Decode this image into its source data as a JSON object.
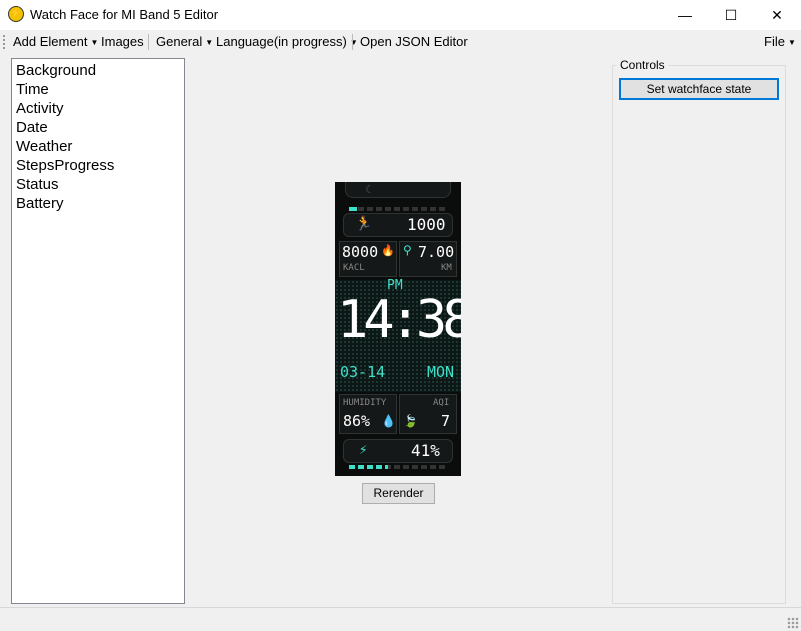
{
  "window": {
    "title": "Watch Face for MI Band 5 Editor",
    "minimize_glyph": "—",
    "maximize_glyph": "☐",
    "close_glyph": "✕"
  },
  "menu": {
    "add_element": "Add Element",
    "images": "Images",
    "general": "General",
    "language": "Language(in progress)",
    "open_json": "Open JSON Editor",
    "file": "File"
  },
  "elements": [
    "Background",
    "Time",
    "Activity",
    "Date",
    "Weather",
    "StepsProgress",
    "Status",
    "Battery"
  ],
  "controls": {
    "label": "Controls",
    "set_state_button": "Set watchface state"
  },
  "rerender_button": "Rerender",
  "watch": {
    "steps": "1000",
    "kcal_value": "8000",
    "kcal_label": "KACL",
    "distance_value": "7.00",
    "distance_label": "KM",
    "ampm": "PM",
    "time": "14:38",
    "date": "03-14",
    "weekday": "MON",
    "humidity_label": "HUMIDITY",
    "humidity_value": "86%",
    "aqi_label": "AQI",
    "aqi_value": "7",
    "battery_value": "41%",
    "step_progress": 0.08,
    "battery_progress": 0.4
  },
  "colors": {
    "accent_teal": "#3fe0c9",
    "focus_border": "#0078d7"
  }
}
